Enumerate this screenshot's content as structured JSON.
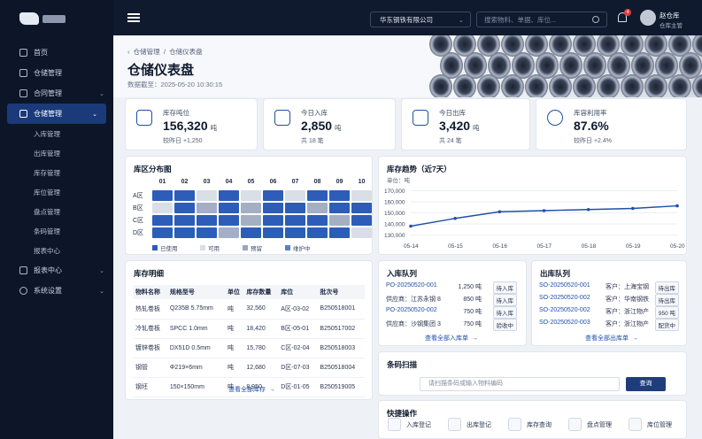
{
  "sidebar": {
    "items": [
      {
        "label": "首页"
      },
      {
        "label": "仓储管理"
      },
      {
        "label": "合同管理"
      },
      {
        "label": "仓储管理"
      },
      {
        "label": "报表中心"
      },
      {
        "label": "系统设置"
      }
    ],
    "sub_items": [
      "入库管理",
      "出库管理",
      "库存管理",
      "库位管理",
      "盘点管理",
      "条码管理",
      "报表中心"
    ]
  },
  "topbar": {
    "company": "华东钢铁有限公司",
    "search_placeholder": "搜索物料、单据、库位...",
    "badge": "4",
    "user_name": "赵仓库",
    "user_role": "仓库主管"
  },
  "header": {
    "breadcrumb_root": "仓储管理",
    "breadcrumb_sep": "/",
    "breadcrumb_current": "仓储仪表盘",
    "title": "仓储仪表盘",
    "as_of": "数据截至：2025-05-20  10:30:15"
  },
  "kpis": [
    {
      "label": "库存吨位",
      "value": "156,320",
      "unit": "吨",
      "sub": "较昨日  +1,250"
    },
    {
      "label": "今日入库",
      "value": "2,850",
      "unit": "吨",
      "sub": "共 18 笔"
    },
    {
      "label": "今日出库",
      "value": "3,420",
      "unit": "吨",
      "sub": "共 24 笔"
    },
    {
      "label": "库容利用率",
      "value": "87.6%",
      "unit": "",
      "sub": "较昨日  +2.4%"
    }
  ],
  "heatmap": {
    "title": "库区分布图",
    "columns": [
      "01",
      "02",
      "03",
      "04",
      "05",
      "06",
      "07",
      "08",
      "09",
      "10"
    ],
    "rows": [
      "A区",
      "B区",
      "C区",
      "D区"
    ],
    "cells": [
      [
        "used",
        "used",
        "free",
        "used",
        "free",
        "used",
        "free",
        "used",
        "used",
        "free"
      ],
      [
        "free",
        "used",
        "reserved",
        "used",
        "reserved",
        "used",
        "used",
        "reserved",
        "used",
        "used"
      ],
      [
        "used",
        "used",
        "used",
        "used",
        "reserved",
        "used",
        "used",
        "used",
        "reserved",
        "used"
      ],
      [
        "used",
        "used",
        "used",
        "reserved",
        "used",
        "used",
        "used",
        "used",
        "used",
        "free"
      ]
    ],
    "legend": [
      {
        "label": "已使用",
        "color": "#2d5db8"
      },
      {
        "label": "可用",
        "color": "#d9dee7"
      },
      {
        "label": "预留",
        "color": "#9aa6bb"
      },
      {
        "label": "维护中",
        "color": "#5b7fc9"
      }
    ],
    "colors": {
      "used": "#2d5db8",
      "free": "#d9dee7",
      "reserved": "#a4afc3",
      "maint": "#5b7fc9"
    }
  },
  "chart_data": {
    "type": "line",
    "title": "库存趋势（近7天）",
    "ylabel": "单位：吨",
    "x": [
      "05-14",
      "05-15",
      "05-16",
      "05-17",
      "05-18",
      "05-19",
      "05-20"
    ],
    "series": [
      {
        "values": [
          138000,
          145000,
          151000,
          152000,
          153000,
          154000,
          156320
        ]
      }
    ],
    "y_ticks": [
      "170,000",
      "160,000",
      "150,000",
      "140,000",
      "130,000"
    ],
    "ylim": [
      128000,
      172000
    ],
    "grid": true
  },
  "inventory": {
    "title": "库存明细",
    "headers": [
      "物料名称",
      "规格型号",
      "单位",
      "库存数量",
      "库位",
      "批次号"
    ],
    "rows": [
      [
        "热轧卷板",
        "Q235B 5.75mm",
        "吨",
        "32,560",
        "A区-03-02",
        "B250518001"
      ],
      [
        "冷轧卷板",
        "SPCC 1.0mm",
        "吨",
        "18,420",
        "B区-05-01",
        "B250517002"
      ],
      [
        "镀锌卷板",
        "DX51D 0.5mm",
        "吨",
        "15,780",
        "C区-02-04",
        "B250518003"
      ],
      [
        "钢管",
        "Φ219×6mm",
        "吨",
        "12,680",
        "D区-07-03",
        "B250518004"
      ],
      [
        "钢坯",
        "150×150mm",
        "吨",
        "8,950",
        "D区-01-05",
        "B250519005"
      ]
    ],
    "more": "查看全部库存"
  },
  "inbound": {
    "title": "入库队列",
    "rows": [
      {
        "id": "PO-20250520-001",
        "qty": "1,250 吨",
        "status": "待入库",
        "link": true
      },
      {
        "id": "供应商：江苏永钢 8",
        "qty": "850 吨",
        "status": "待入库",
        "link": false
      },
      {
        "id": "PO-20250520-002",
        "qty": "750 吨",
        "status": "待入库",
        "link": true
      },
      {
        "id": "供应商：沙钢集团 3",
        "qty": "750 吨",
        "status": "验收中",
        "link": false
      }
    ],
    "more": "查看全部入库单"
  },
  "outbound": {
    "title": "出库队列",
    "rows": [
      {
        "id": "SO-20250520-001",
        "qty": "客户：上海宝钢",
        "status": "待出库"
      },
      {
        "id": "SO-20250520-002",
        "qty": "客户：华南钢铁",
        "status": "待出库"
      },
      {
        "id": "SO-20250520-002",
        "qty": "客户：浙江物产",
        "status": "950 吨"
      },
      {
        "id": "SO-20250520-003",
        "qty": "客户：浙江物产",
        "status": "配货中"
      }
    ],
    "more": "查看全部出库单"
  },
  "scan": {
    "title": "条码扫描",
    "placeholder": "请扫描条码或输入物料编码",
    "button": "查询"
  },
  "quick": {
    "title": "快捷操作",
    "items": [
      "入库登记",
      "出库登记",
      "库存查询",
      "盘点管理",
      "库位管理"
    ]
  }
}
